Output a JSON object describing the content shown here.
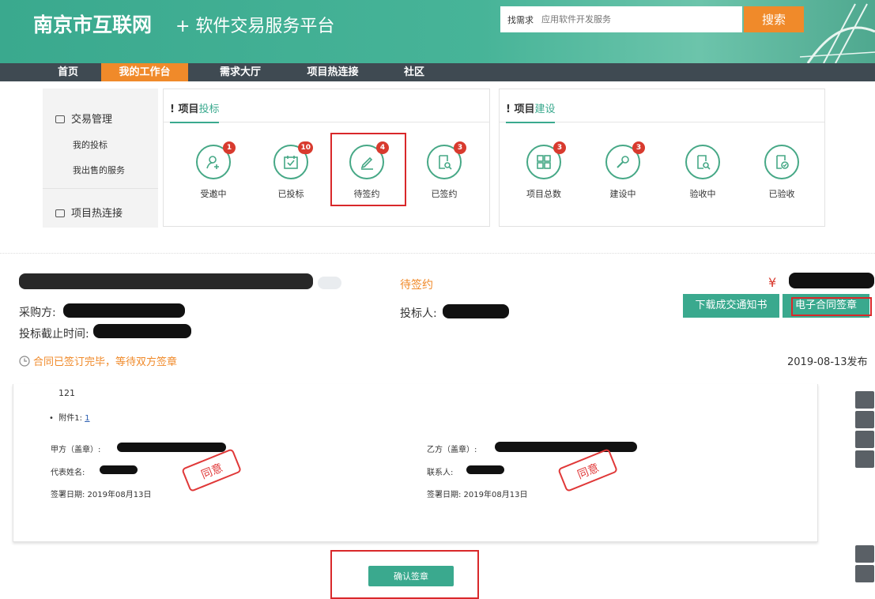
{
  "header": {
    "site_title": "南京市互联网",
    "site_subtitle": "+ 软件交易服务平台",
    "search_label": "找需求",
    "search_placeholder": "应用软件开发服务",
    "search_button": "搜索"
  },
  "nav": [
    "首页",
    "我的工作台",
    "需求大厅",
    "项目热连接",
    "社区"
  ],
  "nav_active": "我的工作台",
  "sidebar": {
    "group1": "交易管理",
    "items": [
      "我的投标",
      "我出售的服务"
    ],
    "group2": "项目热连接"
  },
  "bid_panel": {
    "title_prefix": "! 项目",
    "title_accent": "投标",
    "stats": [
      {
        "label": "受邀中",
        "count": "1",
        "icon": "person-add-icon"
      },
      {
        "label": "已投标",
        "count": "10",
        "icon": "calendar-check-icon"
      },
      {
        "label": "待签约",
        "count": "4",
        "icon": "pen-icon"
      },
      {
        "label": "已签约",
        "count": "3",
        "icon": "document-search-icon"
      }
    ]
  },
  "build_panel": {
    "title_prefix": "! 项目",
    "title_accent": "建设",
    "stats": [
      {
        "label": "项目总数",
        "count": "3",
        "icon": "grid-icon"
      },
      {
        "label": "建设中",
        "count": "3",
        "icon": "wrench-icon"
      },
      {
        "label": "验收中",
        "count": "",
        "icon": "document-search-icon"
      },
      {
        "label": "已验收",
        "count": "",
        "icon": "document-check-icon"
      }
    ]
  },
  "project": {
    "status": "待签约",
    "currency": "¥",
    "buyer_label": "采购方:",
    "bidder_label": "投标人:",
    "deadline_label": "投标截止时间:",
    "notice": "合同已签订完毕，等待双方签章",
    "publish_date": "2019-08-13发布",
    "btn_download": "下载成交通知书",
    "btn_esign": "电子合同签章"
  },
  "contract": {
    "number": "121",
    "attachment_label": "附件1:",
    "attachment_link": "1",
    "party_a": "甲方（盖章）:",
    "party_a_rep": "代表姓名:",
    "party_a_date": "签署日期:  2019年08月13日",
    "party_b": "乙方（盖章）:",
    "party_b_contact": "联系人:",
    "party_b_date": "签署日期:  2019年08月13日",
    "stamp_text": "同意"
  },
  "confirm_button": "确认签章",
  "colors": {
    "brand": "#3aa98e",
    "accent": "#f08a2a",
    "badge": "#d83a2e",
    "highlight": "#d9282a"
  }
}
